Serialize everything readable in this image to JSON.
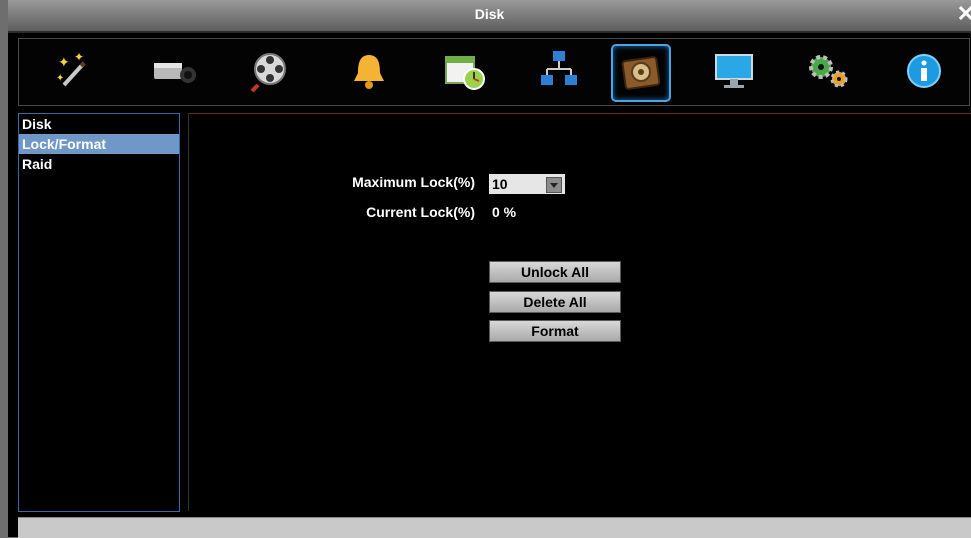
{
  "window": {
    "title": "Disk",
    "close_symbol": "✕"
  },
  "toolbar": {
    "items": [
      {
        "icon": "magic-wand-icon"
      },
      {
        "icon": "camera-icon"
      },
      {
        "icon": "film-reel-icon"
      },
      {
        "icon": "bell-icon"
      },
      {
        "icon": "schedule-icon"
      },
      {
        "icon": "network-icon"
      },
      {
        "icon": "disk-icon",
        "active": true
      },
      {
        "icon": "monitor-icon"
      },
      {
        "icon": "gears-icon"
      },
      {
        "icon": "info-icon"
      }
    ]
  },
  "sidebar": {
    "items": [
      {
        "label": "Disk"
      },
      {
        "label": "Lock/Format",
        "selected": true
      },
      {
        "label": "Raid"
      }
    ]
  },
  "form": {
    "max_lock_label": "Maximum Lock(%)",
    "max_lock_value": "10",
    "current_lock_label": "Current Lock(%)",
    "current_lock_value": "0 %"
  },
  "buttons": {
    "unlock_all": "Unlock All",
    "delete_all": "Delete All",
    "format": "Format"
  },
  "colors": {
    "selection": "#6f98c6",
    "active_border": "#4ea3e5"
  }
}
